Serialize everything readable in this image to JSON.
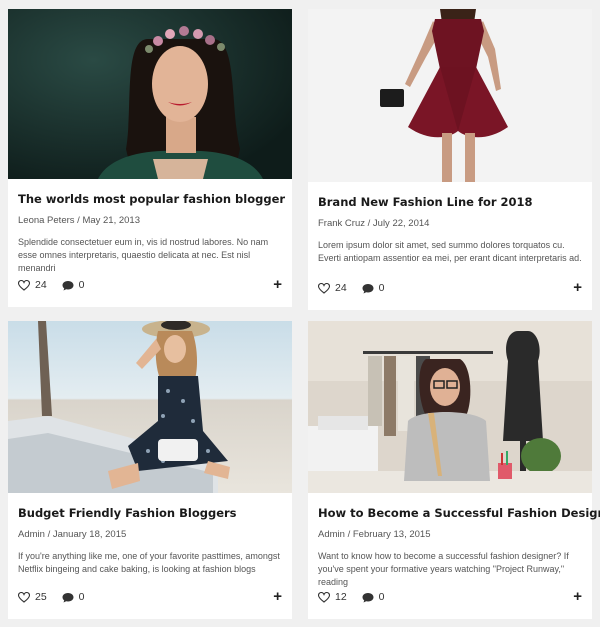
{
  "cards": [
    {
      "title": "The worlds most popular fashion blogger",
      "author": "Leona Peters",
      "date": "May 21, 2013",
      "excerpt": "Splendide consectetuer eum in, vis id nostrud labores. No nam esse omnes interpretaris, quaestio delicata at nec. Est nisl menandri",
      "likes": "24",
      "comments": "0",
      "image_icon": "woman-flower-crown-photo"
    },
    {
      "title": "Brand New Fashion Line for 2018",
      "author": "Frank Cruz",
      "date": "July 22, 2014",
      "excerpt": "Lorem ipsum dolor sit amet, sed summo dolores torquatos cu. Everti antiopam assentior ea mei, per erant dicant interpretaris ad.",
      "likes": "24",
      "comments": "0",
      "image_icon": "red-dress-model-photo"
    },
    {
      "title": "Budget Friendly Fashion Bloggers",
      "author": "Admin",
      "date": "January 18, 2015",
      "excerpt": "If you're anything like me, one of your favorite pasttimes, amongst Netflix bingeing and cake baking, is looking at fashion blogs",
      "likes": "25",
      "comments": "0",
      "image_icon": "beach-hat-model-photo"
    },
    {
      "title": "How to Become a Successful Fashion Designer",
      "author": "Admin",
      "date": "February 13, 2015",
      "excerpt": "Want to know how to become a successful fashion designer? If you've spent your formative years watching \"Project Runway,\" reading",
      "likes": "12",
      "comments": "0",
      "image_icon": "designer-studio-photo"
    }
  ],
  "meta_separator": "/",
  "more_symbol": "+",
  "colors": {
    "page_bg": "#f0f0f0",
    "card_bg": "#ffffff",
    "title": "#1a1a1a",
    "meta": "#555555"
  }
}
